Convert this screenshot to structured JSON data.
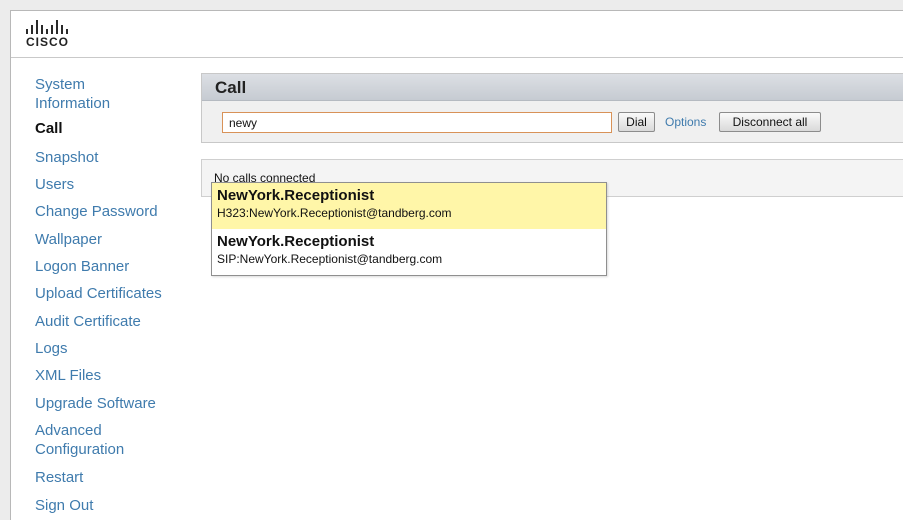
{
  "logo": {
    "text": "CISCO"
  },
  "sidebar": {
    "items": [
      {
        "label": "System Information",
        "active": false
      },
      {
        "label": "Call",
        "active": true
      },
      {
        "label": "Snapshot",
        "active": false
      },
      {
        "label": "Users",
        "active": false
      },
      {
        "label": "Change Password",
        "active": false
      },
      {
        "label": "Wallpaper",
        "active": false
      },
      {
        "label": "Logon Banner",
        "active": false
      },
      {
        "label": "Upload Certificates",
        "active": false
      },
      {
        "label": "Audit Certificate",
        "active": false
      },
      {
        "label": "Logs",
        "active": false
      },
      {
        "label": "XML Files",
        "active": false
      },
      {
        "label": "Upgrade Software",
        "active": false
      },
      {
        "label": "Advanced Configuration",
        "active": false
      },
      {
        "label": "Restart",
        "active": false
      },
      {
        "label": "Sign Out",
        "active": false
      }
    ]
  },
  "call_panel": {
    "title": "Call",
    "input_value": "newy",
    "dial_label": "Dial",
    "options_label": "Options",
    "disconnect_label": "Disconnect all"
  },
  "status": {
    "text": "No calls connected"
  },
  "suggestions": [
    {
      "name": "NewYork.Receptionist",
      "address": "H323:NewYork.Receptionist@tandberg.com",
      "highlighted": true
    },
    {
      "name": "NewYork.Receptionist",
      "address": "SIP:NewYork.Receptionist@tandberg.com",
      "highlighted": false
    }
  ],
  "colors": {
    "link": "#3f7bad",
    "highlight": "#fff6a8",
    "input_border": "#d89258"
  }
}
